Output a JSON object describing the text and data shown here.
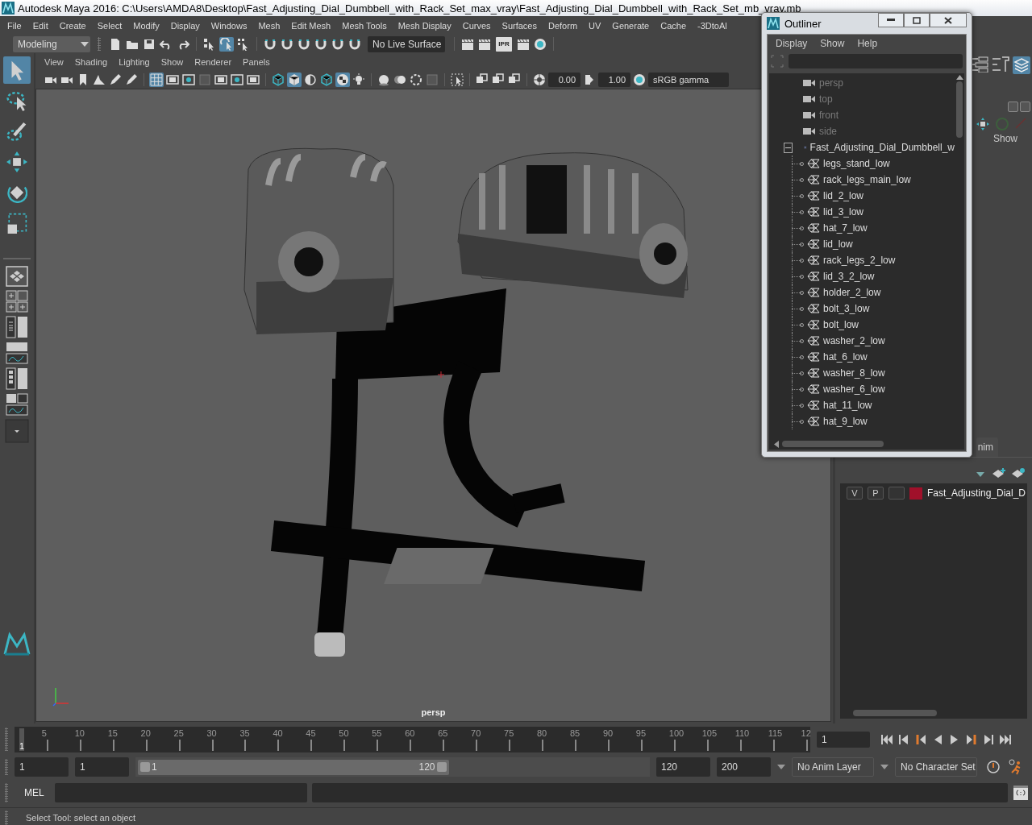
{
  "title_bar": {
    "title": "Autodesk Maya 2016: C:\\Users\\AMDA8\\Desktop\\Fast_Adjusting_Dial_Dumbbell_with_Rack_Set_max_vray\\Fast_Adjusting_Dial_Dumbbell_with_Rack_Set_mb_vray.mb"
  },
  "menu_bar": [
    "File",
    "Edit",
    "Create",
    "Select",
    "Modify",
    "Display",
    "Windows",
    "Mesh",
    "Edit Mesh",
    "Mesh Tools",
    "Mesh Display",
    "Curves",
    "Surfaces",
    "Deform",
    "UV",
    "Generate",
    "Cache",
    "-3DtoAl"
  ],
  "main_toolbar": {
    "mode": "Modeling",
    "live_surface": "No Live Surface",
    "ipr_label": "IPR",
    "groups": [
      [
        {
          "on": false
        },
        {
          "on": false
        },
        {
          "on": false
        },
        {
          "on": false
        },
        {
          "on": false
        }
      ],
      [
        {
          "on": false
        },
        {
          "on": true
        },
        {
          "on": false
        }
      ],
      [
        {
          "on": false
        },
        {
          "on": false
        },
        {
          "on": false
        },
        {
          "on": false
        },
        {
          "on": false
        },
        {
          "on": false
        }
      ],
      [
        {
          "on": false
        },
        {
          "on": false
        },
        {
          "on": false
        },
        {
          "on": false
        },
        {
          "on": false
        }
      ]
    ]
  },
  "tool_box": [
    {
      "selected": true
    },
    {
      "selected": false
    },
    {
      "selected": false
    },
    {
      "selected": false
    },
    {
      "selected": false
    },
    {
      "selected": false
    }
  ],
  "viewport": {
    "menu": [
      "View",
      "Shading",
      "Lighting",
      "Show",
      "Renderer",
      "Panels"
    ],
    "groups": [
      [
        {
          "on": false
        },
        {
          "on": false
        },
        {
          "on": false
        },
        {
          "on": false
        },
        {
          "on": false
        },
        {
          "on": false
        }
      ],
      [
        {
          "on": true
        },
        {
          "on": false
        },
        {
          "on": false
        },
        {
          "on": false
        },
        {
          "on": false
        },
        {
          "on": false
        },
        {
          "on": false
        }
      ],
      [
        {
          "on": false
        },
        {
          "on": true
        },
        {
          "on": false
        },
        {
          "on": false
        },
        {
          "on": true
        },
        {
          "on": false
        }
      ],
      [
        {
          "on": false
        },
        {
          "on": false
        },
        {
          "on": false
        },
        {
          "on": false
        }
      ],
      [
        {
          "on": false
        }
      ],
      [
        {
          "on": false
        },
        {
          "on": false
        },
        {
          "on": false
        }
      ]
    ],
    "exposure": "0.00",
    "gamma": "1.00",
    "color_space": "sRGB gamma",
    "camera_label": "persp"
  },
  "outliner": {
    "title": "Outliner",
    "menu": [
      "Display",
      "Show",
      "Help"
    ],
    "items": [
      {
        "label": "persp",
        "kind": "camera"
      },
      {
        "label": "top",
        "kind": "camera"
      },
      {
        "label": "front",
        "kind": "camera"
      },
      {
        "label": "side",
        "kind": "camera"
      },
      {
        "label": "Fast_Adjusting_Dial_Dumbbell_w",
        "kind": "group",
        "expanded": true,
        "children": [
          {
            "label": "legs_stand_low",
            "kind": "mesh"
          },
          {
            "label": "rack_legs_main_low",
            "kind": "mesh"
          },
          {
            "label": "lid_2_low",
            "kind": "mesh"
          },
          {
            "label": "lid_3_low",
            "kind": "mesh"
          },
          {
            "label": "hat_7_low",
            "kind": "mesh"
          },
          {
            "label": "lid_low",
            "kind": "mesh"
          },
          {
            "label": "rack_legs_2_low",
            "kind": "mesh"
          },
          {
            "label": "lid_3_2_low",
            "kind": "mesh"
          },
          {
            "label": "holder_2_low",
            "kind": "mesh"
          },
          {
            "label": "bolt_3_low",
            "kind": "mesh"
          },
          {
            "label": "bolt_low",
            "kind": "mesh"
          },
          {
            "label": "washer_2_low",
            "kind": "mesh"
          },
          {
            "label": "hat_6_low",
            "kind": "mesh"
          },
          {
            "label": "washer_8_low",
            "kind": "mesh"
          },
          {
            "label": "washer_6_low",
            "kind": "mesh"
          },
          {
            "label": "hat_11_low",
            "kind": "mesh"
          },
          {
            "label": "hat_9_low",
            "kind": "mesh"
          }
        ]
      }
    ]
  },
  "side_panel": {
    "show_label": "Show",
    "tab_label": "nim",
    "layers": [
      {
        "visible": "V",
        "playback": "P",
        "color": "#a0102a",
        "name": "Fast_Adjusting_Dial_D"
      }
    ]
  },
  "time_slider": {
    "ticks": [
      "5",
      "10",
      "15",
      "20",
      "25",
      "30",
      "35",
      "40",
      "45",
      "50",
      "55",
      "60",
      "65",
      "70",
      "75",
      "80",
      "85",
      "90",
      "95",
      "100",
      "105",
      "110",
      "115",
      "12"
    ],
    "current": "1",
    "level": 0,
    "current_frame": "1"
  },
  "range_bar": {
    "level": 0.61,
    "start": "1",
    "anim_start": "1",
    "range_start": "1",
    "range_end": "120",
    "end": "120",
    "anim_end": "200",
    "anim_layer": "No Anim Layer",
    "character_set": "No Character Set"
  },
  "command_line": {
    "language": "MEL"
  },
  "help_line": "Select Tool: select an object"
}
